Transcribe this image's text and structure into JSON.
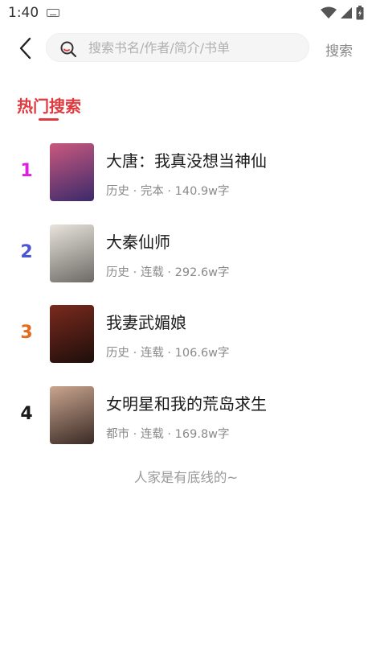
{
  "status_bar": {
    "time": "1:40"
  },
  "search": {
    "placeholder": "搜索书名/作者/简介/书单",
    "submit_label": "搜索"
  },
  "section": {
    "title": "热门搜索"
  },
  "books": [
    {
      "rank": "1",
      "rank_color": "#e01de0",
      "title": "大唐：我真没想当神仙",
      "meta": "历史 · 完本 · 140.9w字",
      "cover_colors": [
        "#c9587f",
        "#3b2a6a"
      ]
    },
    {
      "rank": "2",
      "rank_color": "#4a55d6",
      "title": "大秦仙师",
      "meta": "历史 · 连载 · 292.6w字",
      "cover_colors": [
        "#e8e4dc",
        "#6d6a66"
      ]
    },
    {
      "rank": "3",
      "rank_color": "#e56a1c",
      "title": "我妻武媚娘",
      "meta": "历史 · 连载 · 106.6w字",
      "cover_colors": [
        "#7a2a1d",
        "#1e0e0b"
      ]
    },
    {
      "rank": "4",
      "rank_color": "#1a1a1a",
      "title": "女明星和我的荒岛求生",
      "meta": "都市 · 连载 · 169.8w字",
      "cover_colors": [
        "#c9a58f",
        "#3a2a25"
      ]
    }
  ],
  "footer": {
    "end_note": "人家是有底线的~"
  }
}
